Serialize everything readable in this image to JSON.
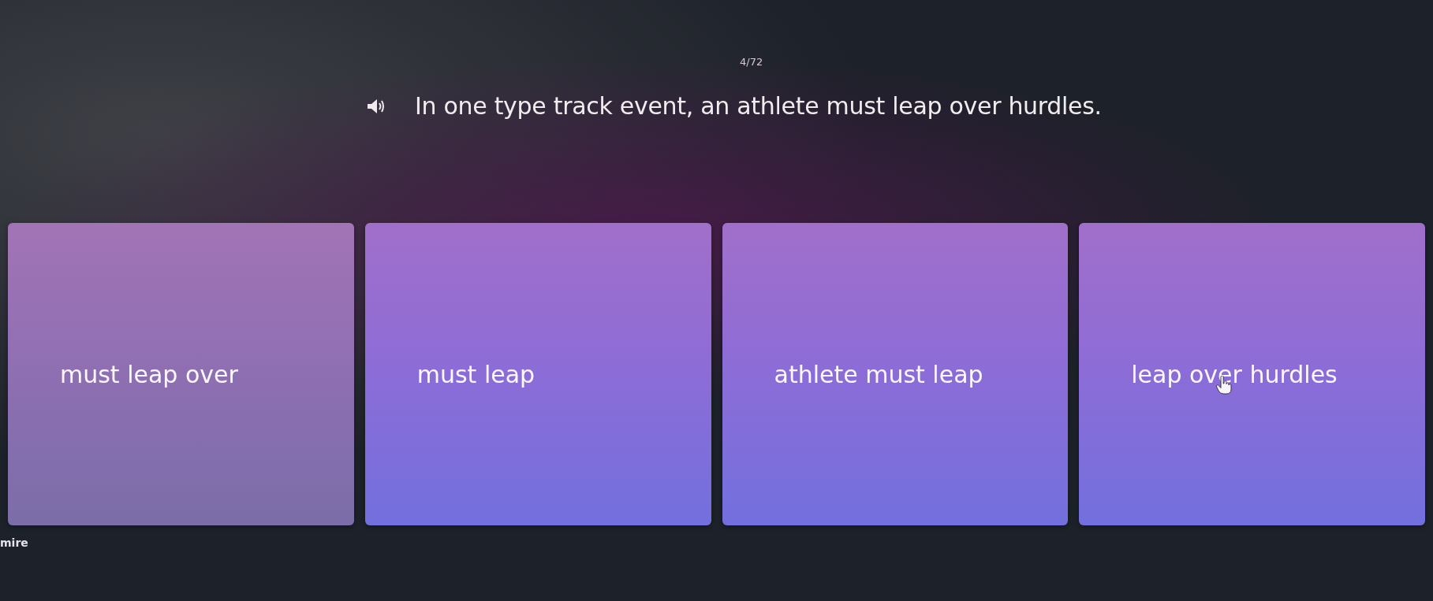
{
  "counter": "4/72",
  "question": {
    "text": "In one type track event, an athlete must leap over hurdles."
  },
  "options": [
    {
      "label": "must leap over",
      "hovered": false
    },
    {
      "label": "must leap",
      "hovered": false
    },
    {
      "label": "athlete must leap",
      "hovered": false
    },
    {
      "label": "leap over hurdles",
      "hovered": true
    }
  ],
  "footer_text": "mire"
}
